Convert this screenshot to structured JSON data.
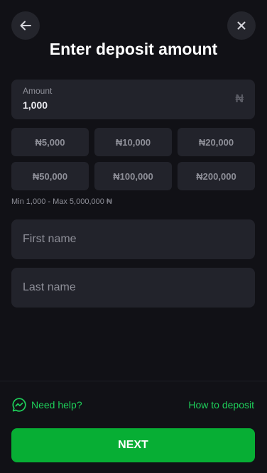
{
  "header": {
    "title": "Enter deposit amount",
    "back_icon": "arrow-left-icon",
    "close_icon": "close-icon"
  },
  "amount": {
    "label": "Amount",
    "value": "1,000",
    "currency": "₦"
  },
  "presets": [
    "₦5,000",
    "₦10,000",
    "₦20,000",
    "₦50,000",
    "₦100,000",
    "₦200,000"
  ],
  "limits": "Min 1,000 - Max 5,000,000 ₦",
  "form": {
    "first_name_placeholder": "First name",
    "last_name_placeholder": "Last name"
  },
  "footer": {
    "help_label": "Need help?",
    "help_icon": "chat-help-icon",
    "how_to_label": "How to deposit",
    "next_label": "NEXT"
  },
  "colors": {
    "background": "#111116",
    "surface": "#22232b",
    "accent_green": "#1ecf5a",
    "button_green": "#07ae34"
  }
}
